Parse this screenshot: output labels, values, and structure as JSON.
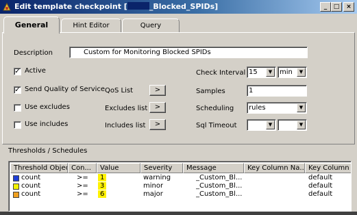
{
  "window": {
    "title": "Edit template checkpoint [",
    "title_suffix": "_Blocked_SPIDs]",
    "minimize": "_",
    "maximize": "□",
    "close": "×"
  },
  "tabs": [
    {
      "label": "General",
      "active": true
    },
    {
      "label": "Hint Editor",
      "active": false
    },
    {
      "label": "Query",
      "active": false
    }
  ],
  "form": {
    "description_label": "Description",
    "description_value": "Custom for Monitoring Blocked SPIDs",
    "active": {
      "label": "Active",
      "checked": true
    },
    "send_qos": {
      "label": "Send Quality of Service",
      "checked": true
    },
    "use_excludes": {
      "label": "Use excludes",
      "checked": false
    },
    "use_includes": {
      "label": "Use includes",
      "checked": false
    },
    "qos_list": {
      "label": "QoS List",
      "button": ">"
    },
    "excludes_list": {
      "label": "Excludes list",
      "button": ">"
    },
    "includes_list": {
      "label": "Includes list",
      "button": ">"
    },
    "check_interval": {
      "label": "Check Interval",
      "value": "15",
      "unit": "min"
    },
    "samples": {
      "label": "Samples",
      "value": "1"
    },
    "scheduling": {
      "label": "Scheduling",
      "value": "rules"
    },
    "sql_timeout": {
      "label": "Sql Timeout",
      "value": "",
      "unit": ""
    }
  },
  "thresholds": {
    "section_label": "Thresholds / Schedules",
    "columns": [
      "Threshold Object",
      "Con...",
      "Value",
      "Severity",
      "Message",
      "Key Column Na...",
      "Key Column V"
    ],
    "rows": [
      {
        "object": "count",
        "condition": ">=",
        "value": "1",
        "severity": "warning",
        "message": "_Custom_Bl...",
        "key_name": "",
        "key_value": "default",
        "color": "#1f3fd6"
      },
      {
        "object": "count",
        "condition": ">=",
        "value": "3",
        "severity": "minor",
        "message": "_Custom_Bl...",
        "key_name": "",
        "key_value": "default",
        "color": "#f2f200"
      },
      {
        "object": "count",
        "condition": ">=",
        "value": "6",
        "severity": "major",
        "message": "_Custom_Bl...",
        "key_name": "",
        "key_value": "default",
        "color": "#f0a020"
      }
    ]
  },
  "colors": {
    "title_start": "#0a246a",
    "title_end": "#a6caf0",
    "face": "#d4d0c8",
    "highlight": "#fff200"
  }
}
